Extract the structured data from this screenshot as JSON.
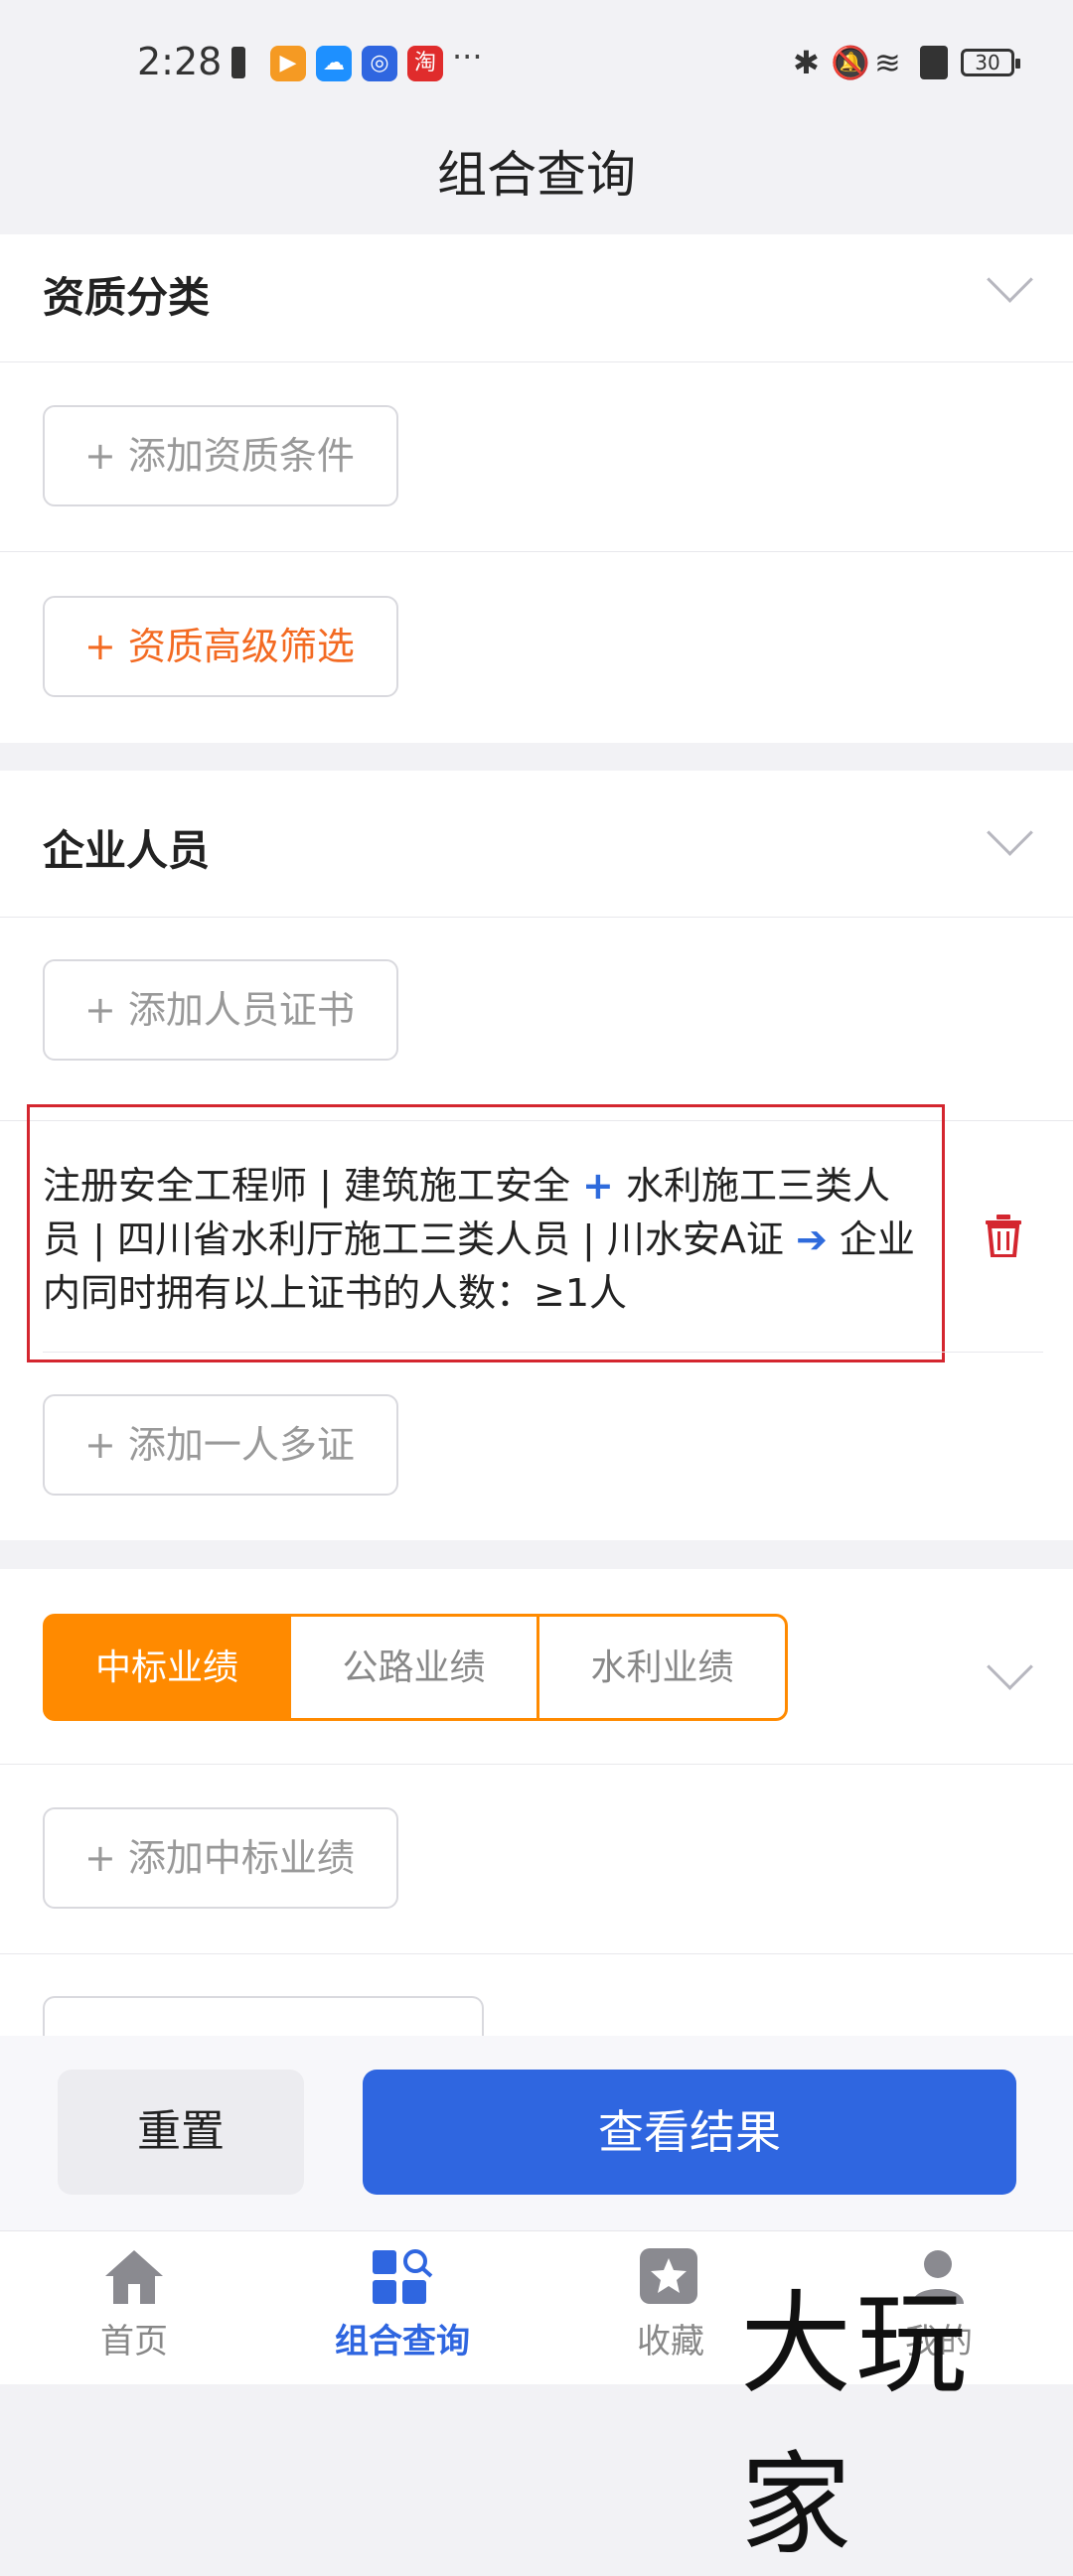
{
  "status_bar": {
    "time": "2:28",
    "battery": "30"
  },
  "page": {
    "title": "组合查询"
  },
  "qualification": {
    "title": "资质分类",
    "add_condition": "+ 添加资质条件",
    "advanced_filter": "+ 资质高级筛选"
  },
  "personnel": {
    "title": "企业人员",
    "add_certificate": "+ 添加人员证书",
    "condition": {
      "part1": "注册安全工程师 | 建筑施工安全 ",
      "plus": "+",
      "part2": " 水利施工三类人员 | 四川省水利厅施工三类人员 | 川水安A证 ",
      "arrow": "➔",
      "part3": " 企业内同时拥有以上证书的人数：≥1人"
    },
    "add_multi_cert": "+ 添加一人多证"
  },
  "performance": {
    "tabs": [
      "中标业绩",
      "公路业绩",
      "水利业绩"
    ],
    "add_bid": "+ 添加中标业绩"
  },
  "actions": {
    "reset": "重置",
    "view_results": "查看结果"
  },
  "bottom_nav": {
    "items": [
      {
        "label": "首页",
        "icon": "home-icon"
      },
      {
        "label": "组合查询",
        "icon": "combo-query-icon"
      },
      {
        "label": "收藏",
        "icon": "favorites-star-icon"
      },
      {
        "label": "我的",
        "icon": "profile-icon"
      }
    ]
  },
  "watermark": "大玩家",
  "colors": {
    "accent_blue": "#2f66e0",
    "accent_orange": "#ff8a00",
    "delete_red": "#d4262f"
  }
}
